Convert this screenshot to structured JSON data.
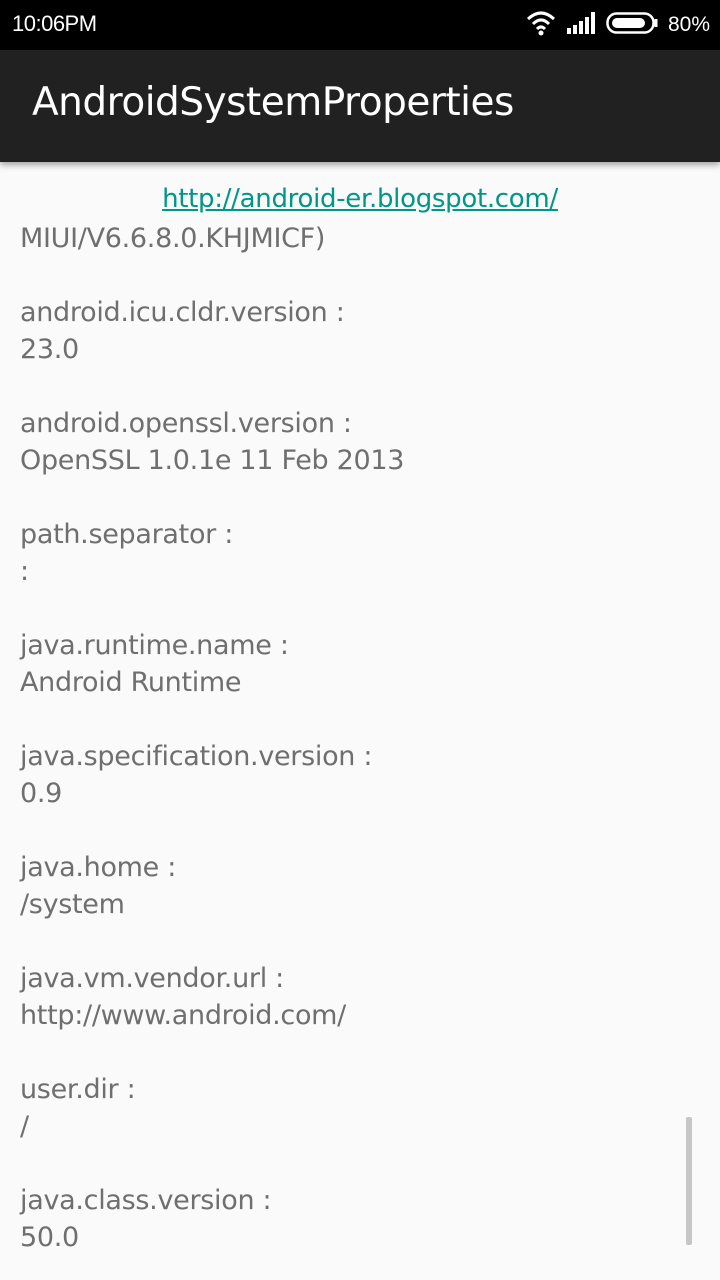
{
  "status_bar": {
    "time": "10:06PM",
    "battery_percent": "80%",
    "icons": [
      "wifi-icon",
      "signal-icon",
      "battery-icon"
    ]
  },
  "app_bar": {
    "title": "AndroidSystemProperties"
  },
  "link": {
    "text": "http://android-er.blogspot.com/",
    "color": "#009688"
  },
  "properties": {
    "partial_value": "MIUI/V6.6.8.0.KHJMICF)",
    "items": [
      {
        "key": "android.icu.cldr.version :",
        "value": "23.0"
      },
      {
        "key": "android.openssl.version :",
        "value": "OpenSSL 1.0.1e 11 Feb 2013"
      },
      {
        "key": "path.separator :",
        "value": ":"
      },
      {
        "key": "java.runtime.name :",
        "value": "Android Runtime"
      },
      {
        "key": "java.specification.version :",
        "value": "0.9"
      },
      {
        "key": "java.home :",
        "value": "/system"
      },
      {
        "key": "java.vm.vendor.url :",
        "value": "http://www.android.com/"
      },
      {
        "key": "user.dir :",
        "value": "/"
      },
      {
        "key": "java.class.version :",
        "value": "50.0"
      }
    ]
  }
}
